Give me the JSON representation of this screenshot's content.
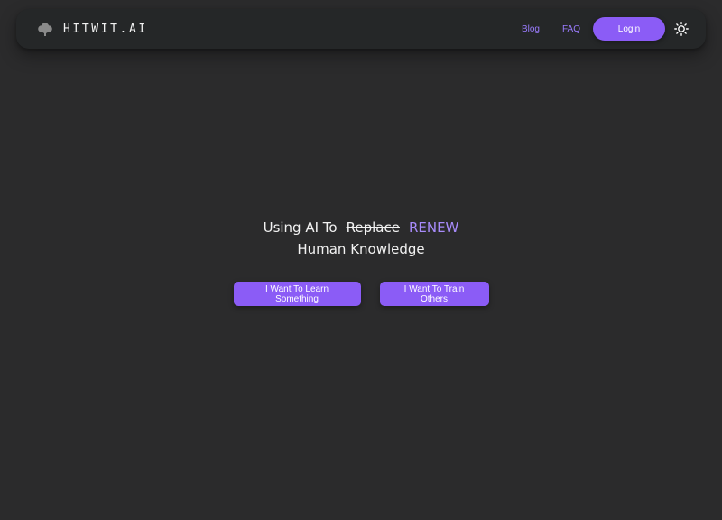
{
  "brand": {
    "name": "HITWIT.AI",
    "logo_icon": "tree-icon"
  },
  "nav": {
    "links": [
      {
        "label": "Blog"
      },
      {
        "label": "FAQ"
      }
    ],
    "login_label": "Login",
    "theme_toggle_icon": "sun-icon"
  },
  "hero": {
    "prefix": "Using AI To",
    "struck": "Replace",
    "highlight": "RENEW",
    "line2": "Human Knowledge"
  },
  "cta": {
    "learn_label": "I Want To Learn Something",
    "train_label": "I Want To Train Others"
  },
  "colors": {
    "background": "#2b2b2c",
    "navbar": "#252728",
    "accent": "#8b5cf6",
    "link": "#9b7cff",
    "highlight": "#a78bfa",
    "text": "#f2f2f2"
  }
}
